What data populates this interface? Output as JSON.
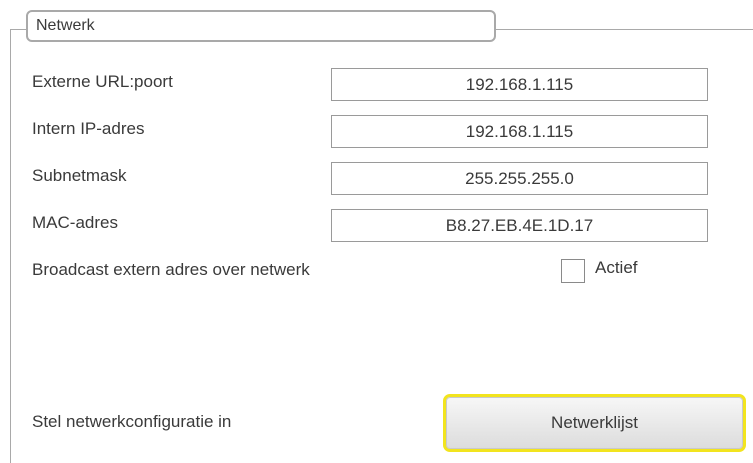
{
  "group": {
    "title": "Netwerk"
  },
  "fields": [
    {
      "label": "Externe URL:poort",
      "value": "192.168.1.115"
    },
    {
      "label": "Intern IP-adres",
      "value": "192.168.1.115"
    },
    {
      "label": "Subnetmask",
      "value": "255.255.255.0"
    },
    {
      "label": "MAC-adres",
      "value": "B8.27.EB.4E.1D.17"
    }
  ],
  "broadcast": {
    "label": "Broadcast extern adres over netwerk",
    "checkbox_label": "Actief",
    "checked": false
  },
  "network_config": {
    "label": "Stel netwerkconfiguratie in",
    "button_label": "Netwerklijst",
    "button_highlight_color": "#f2e41e"
  }
}
